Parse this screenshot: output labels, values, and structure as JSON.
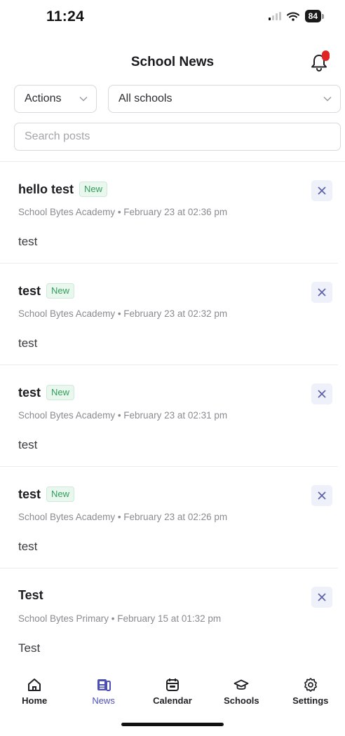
{
  "status_bar": {
    "time": "11:24",
    "battery": "84"
  },
  "header": {
    "title": "School News",
    "notification_icon": "bell-icon"
  },
  "filters": {
    "actions_label": "Actions",
    "school_selected": "All schools"
  },
  "search": {
    "placeholder": "Search posts",
    "value": ""
  },
  "posts": [
    {
      "title": "hello test",
      "badge": "New",
      "meta": "School Bytes Academy • February 23 at 02:36 pm",
      "body": "test"
    },
    {
      "title": "test",
      "badge": "New",
      "meta": "School Bytes Academy • February 23 at 02:32 pm",
      "body": "test"
    },
    {
      "title": "test",
      "badge": "New",
      "meta": "School Bytes Academy • February 23 at 02:31 pm",
      "body": "test"
    },
    {
      "title": "test",
      "badge": "New",
      "meta": "School Bytes Academy • February 23 at 02:26 pm",
      "body": "test"
    },
    {
      "title": "Test",
      "badge": "",
      "meta": "School Bytes Primary • February 15 at 01:32 pm",
      "body": "Test"
    }
  ],
  "tabbar": {
    "items": [
      {
        "label": "Home",
        "icon": "home-icon"
      },
      {
        "label": "News",
        "icon": "news-icon",
        "active": true
      },
      {
        "label": "Calendar",
        "icon": "calendar-icon"
      },
      {
        "label": "Schools",
        "icon": "graduation-cap-icon"
      },
      {
        "label": "Settings",
        "icon": "gear-icon"
      }
    ]
  },
  "colors": {
    "accent": "#4d4fb8",
    "new_badge": "#2f9e5a",
    "notification_badge": "#e02424"
  }
}
